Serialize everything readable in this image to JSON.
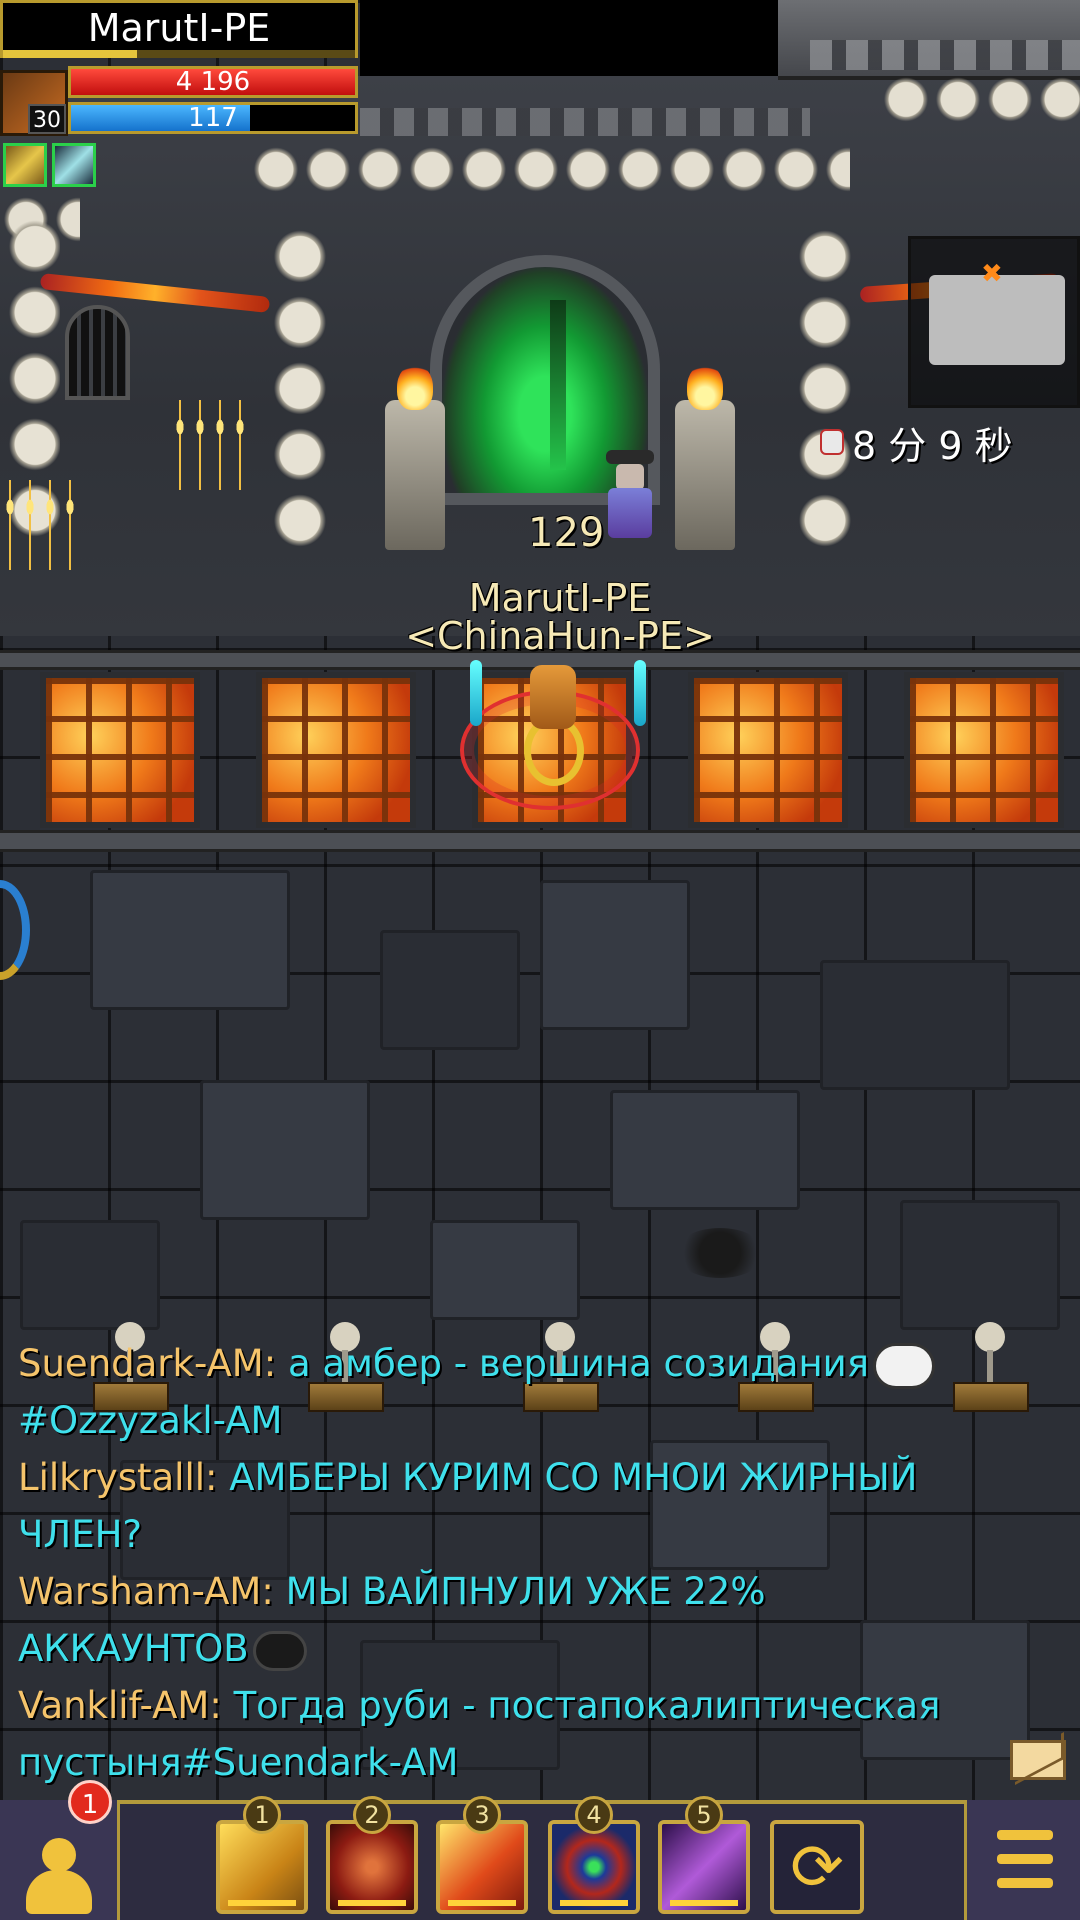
{
  "player": {
    "name": "MarutI-PE",
    "level": "30",
    "hp_text": "4 196",
    "hp_fraction": 1.0,
    "mp_text": "117",
    "mp_fraction": 0.63,
    "xp_fraction": 0.38,
    "class_icon": "bow-icon",
    "buffs": [
      {
        "icon": "golden-feather-buff-icon"
      },
      {
        "icon": "silver-claw-buff-icon"
      }
    ]
  },
  "timer": {
    "text": "8 分 9 秒",
    "icon": "skull-icon"
  },
  "minimap": {
    "marker": "✖"
  },
  "world": {
    "npc_level": "129",
    "hero_name": "MarutI-PE",
    "hero_guild": "<ChinaHun-PE>"
  },
  "chat": [
    {
      "sender": "Suendark-AM:",
      "message": "а амбер - вершина созидания",
      "emoji": "troll-face-emoji"
    },
    {
      "sender": "",
      "message": "#Ozzyzakl-AM"
    },
    {
      "sender": "Lilkrystalll:",
      "message": "АМБЕРЫ КУРИМ СО МНОИ ЖИРНЫЙ"
    },
    {
      "sender": "",
      "message": "ЧЛЕН?"
    },
    {
      "sender": "Warsham-AM:",
      "message": "МЫ ВАЙПНУЛИ УЖЕ 22%"
    },
    {
      "sender": "",
      "message": "АККАУНТОВ",
      "emoji": "grin-face-emoji"
    },
    {
      "sender": "Vanklif-AM:",
      "message": "Тогда руби - постапокалиптическая"
    },
    {
      "sender": "",
      "message": "пустыня#Suendark-AM"
    }
  ],
  "action_bar": {
    "notification_count": "1",
    "skills": [
      {
        "slot": "1",
        "icon": "arrow-volley-icon"
      },
      {
        "slot": "2",
        "icon": "piercing-arrow-icon"
      },
      {
        "slot": "3",
        "icon": "fire-shot-icon"
      },
      {
        "slot": "4",
        "icon": "crosshair-target-icon"
      },
      {
        "slot": "5",
        "icon": "purple-bow-icon"
      }
    ],
    "swap_glyph": "⟳"
  },
  "colors": {
    "chat_sender": "#f5c46b",
    "chat_message": "#3fe0ec",
    "hp": "#d81e1e",
    "mp": "#2e8fe6",
    "frame_gold": "#b89a2d"
  }
}
